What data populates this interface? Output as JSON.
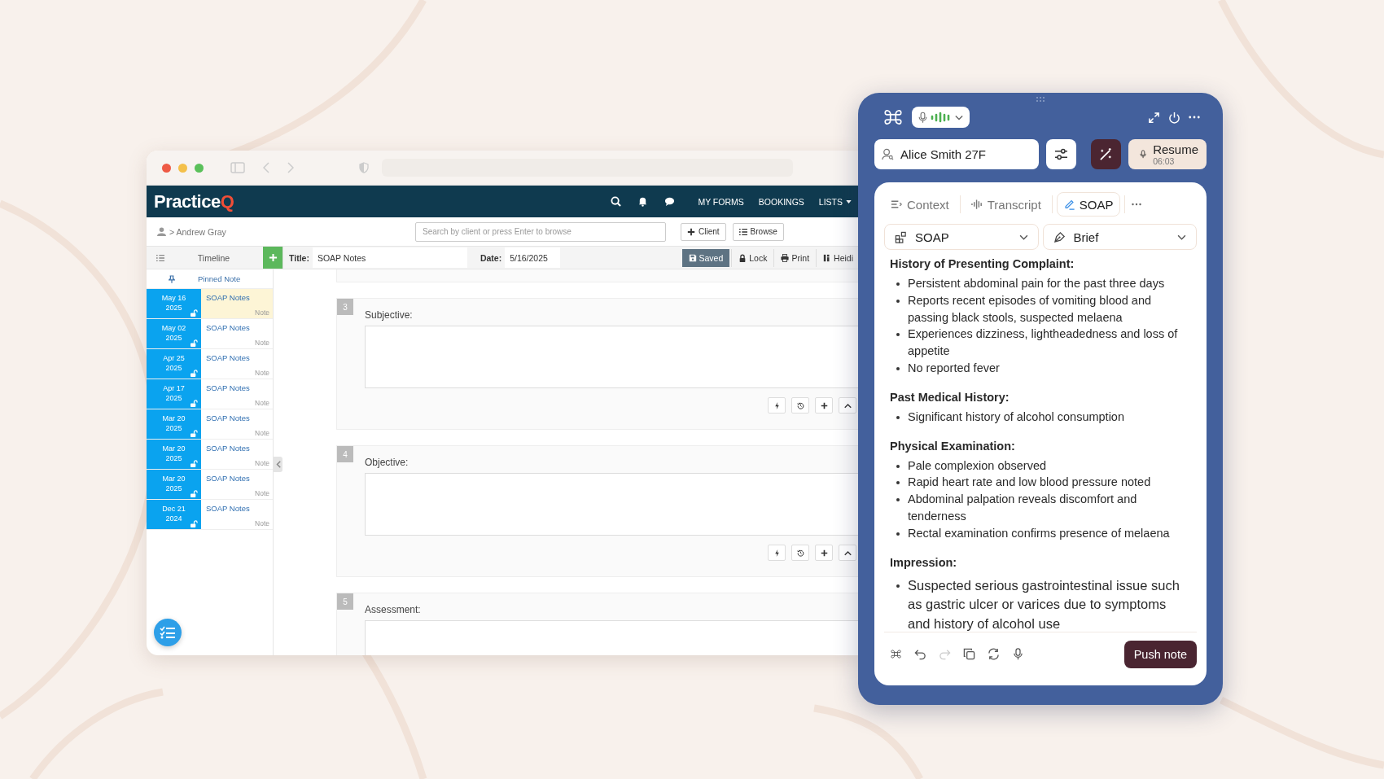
{
  "browser": {
    "logo": {
      "text": "Practice",
      "accent": "Q"
    },
    "nav": [
      {
        "label": "MY FORMS",
        "dropdown": false
      },
      {
        "label": "BOOKINGS",
        "dropdown": false
      },
      {
        "label": "LISTS",
        "dropdown": true
      }
    ],
    "breadcrumb": "> Andrew Gray",
    "search": {
      "placeholder": "Search by client or press Enter to browse"
    },
    "buttons": [
      "Client",
      "Browse"
    ],
    "timeline": {
      "title": "Timeline",
      "pinned": "Pinned Note",
      "notes": [
        {
          "date": "May 16",
          "year": "2025",
          "title": "SOAP Notes",
          "tag": "Note",
          "selected": true
        },
        {
          "date": "May 02",
          "year": "2025",
          "title": "SOAP Notes",
          "tag": "Note",
          "selected": false
        },
        {
          "date": "Apr 25",
          "year": "2025",
          "title": "SOAP Notes",
          "tag": "Note",
          "selected": false
        },
        {
          "date": "Apr 17",
          "year": "2025",
          "title": "SOAP Notes",
          "tag": "Note",
          "selected": false
        },
        {
          "date": "Mar 20",
          "year": "2025",
          "title": "SOAP Notes",
          "tag": "Note",
          "selected": false
        },
        {
          "date": "Mar 20",
          "year": "2025",
          "title": "SOAP Notes",
          "tag": "Note",
          "selected": false
        },
        {
          "date": "Mar 20",
          "year": "2025",
          "title": "SOAP Notes",
          "tag": "Note",
          "selected": false
        },
        {
          "date": "Dec 21",
          "year": "2024",
          "title": "SOAP Notes",
          "tag": "Note",
          "selected": false
        }
      ]
    },
    "form": {
      "title_label": "Title:",
      "title": "SOAP Notes",
      "date_label": "Date:",
      "date": "5/16/2025",
      "actions": [
        {
          "label": "Saved",
          "selected": true
        },
        {
          "label": "Lock",
          "selected": false
        },
        {
          "label": "Print",
          "selected": false
        },
        {
          "label": "Heidi",
          "selected": false
        }
      ],
      "sections": [
        {
          "number": "3",
          "label": "Subjective:"
        },
        {
          "number": "4",
          "label": "Objective:"
        },
        {
          "number": "5",
          "label": "Assessment:"
        }
      ]
    }
  },
  "panel": {
    "patient": "Alice Smith 27F",
    "resume": {
      "label": "Resume",
      "time": "06:03"
    },
    "tabs": [
      {
        "label": "Context",
        "selected": false
      },
      {
        "label": "Transcript",
        "selected": false
      },
      {
        "label": "SOAP",
        "selected": true
      }
    ],
    "selects": [
      "SOAP",
      "Brief"
    ],
    "note": [
      {
        "heading": "History of Presenting Complaint:",
        "large": false,
        "bullets": [
          "Persistent abdominal pain for the past three days",
          "Reports recent episodes of vomiting blood and passing black stools, suspected melaena",
          "Experiences dizziness, lightheadedness and loss of appetite",
          "No reported fever"
        ]
      },
      {
        "heading": "Past Medical History:",
        "large": false,
        "bullets": [
          "Significant history of alcohol consumption"
        ]
      },
      {
        "heading": "Physical Examination:",
        "large": false,
        "bullets": [
          "Pale complexion observed",
          "Rapid heart rate and low blood pressure noted",
          "Abdominal palpation reveals discomfort and tenderness",
          "Rectal examination confirms presence of melaena"
        ]
      },
      {
        "heading": "Impression:",
        "large": true,
        "bullets": [
          "Suspected serious gastrointestinal issue such as gastric ulcer or varices due to symptoms and history of alcohol use"
        ]
      }
    ],
    "tools": [
      {
        "disabled": false
      },
      {
        "disabled": false
      },
      {
        "disabled": true
      },
      {
        "disabled": false
      },
      {
        "disabled": false
      },
      {
        "disabled": false
      }
    ],
    "push": "Push note"
  }
}
